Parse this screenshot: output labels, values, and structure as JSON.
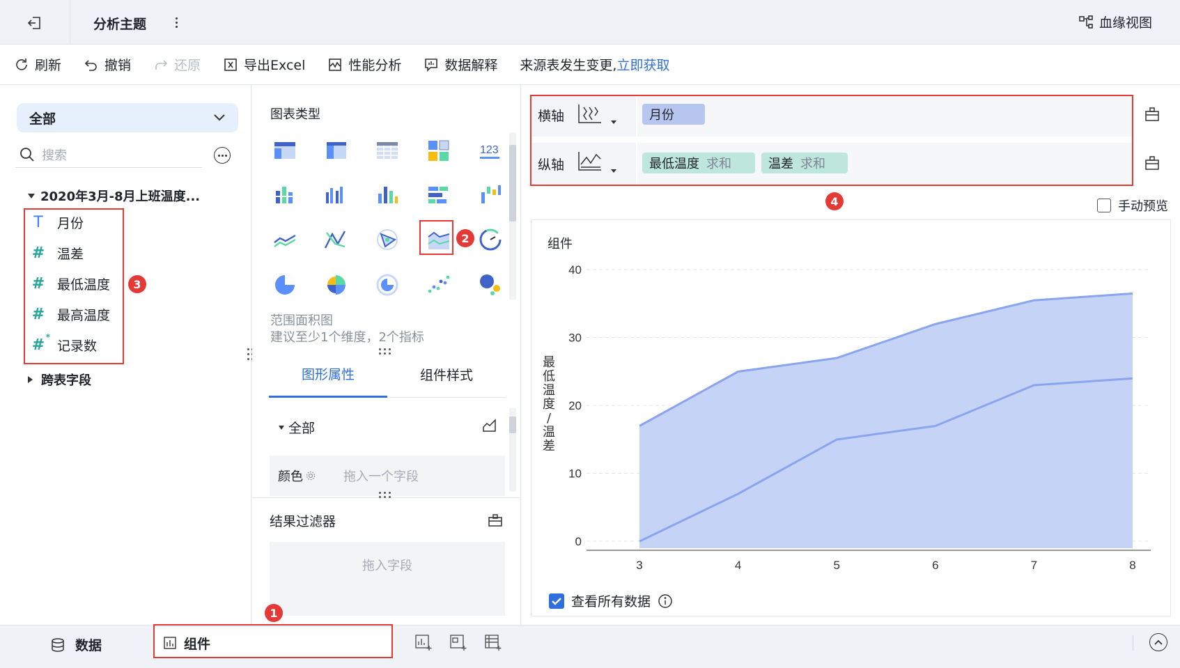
{
  "header": {
    "title": "分析主题",
    "lineage_label": "血缘视图"
  },
  "toolbar": {
    "refresh": "刷新",
    "undo": "撤销",
    "redo": "还原",
    "export": "导出Excel",
    "perf": "性能分析",
    "explain": "数据解释",
    "notice": "来源表发生变更,",
    "notice_link": "立即获取"
  },
  "left": {
    "scope": "全部",
    "search_placeholder": "搜索",
    "dataset": "2020年3月-8月上班温度...",
    "fields": [
      {
        "icon": "text-field-icon",
        "label": "月份"
      },
      {
        "icon": "number-field-icon",
        "label": "温差"
      },
      {
        "icon": "number-field-icon",
        "label": "最低温度"
      },
      {
        "icon": "number-field-icon",
        "label": "最高温度"
      },
      {
        "icon": "computed-number-field-icon",
        "label": "记录数"
      }
    ],
    "cross_table": "跨表字段"
  },
  "middle": {
    "chart_type_title": "图表类型",
    "selected_chart_name": "范围面积图",
    "selected_chart_hint": "建议至少1个维度，2个指标",
    "tab_graph": "图形属性",
    "tab_style": "组件样式",
    "all_section": "全部",
    "color_label": "颜色",
    "color_placeholder": "拖入一个字段",
    "filter_title": "结果过滤器",
    "filter_placeholder": "拖入字段"
  },
  "right": {
    "x_axis_label": "横轴",
    "y_axis_label": "纵轴",
    "x_fields": [
      {
        "name": "月份"
      }
    ],
    "y_fields": [
      {
        "name": "最低温度",
        "agg": "求和"
      },
      {
        "name": "温差",
        "agg": "求和"
      }
    ],
    "manual_preview": "手动预览",
    "chart_title": "组件",
    "view_all": "查看所有数据"
  },
  "bottom": {
    "tab_data": "数据",
    "tab_component": "组件"
  },
  "annotations": [
    "1",
    "2",
    "3",
    "4"
  ],
  "colors": {
    "accent": "#2f6fdd",
    "highlight_red": "#e53935",
    "area_fill": "#c5d3f6",
    "line": "#8aa4ee",
    "dimension_pill": "#b7c6ee",
    "measure_pill": "#bfe6dd"
  },
  "chart_data": {
    "type": "area",
    "categories": [
      "3",
      "4",
      "5",
      "6",
      "7",
      "8"
    ],
    "series": [
      {
        "name": "最低温度",
        "values": [
          1,
          8,
          16,
          18,
          24,
          25
        ]
      },
      {
        "name": "温差",
        "values": [
          17,
          18,
          12,
          15,
          12.5,
          12.5
        ]
      }
    ],
    "upper_values": [
      18,
      26,
      28,
      33,
      36.5,
      37.5
    ],
    "ylabel": "最低温度/温差",
    "yticks": [
      0,
      10,
      20,
      30,
      40
    ],
    "ylim": [
      0,
      40
    ],
    "grid": true
  }
}
